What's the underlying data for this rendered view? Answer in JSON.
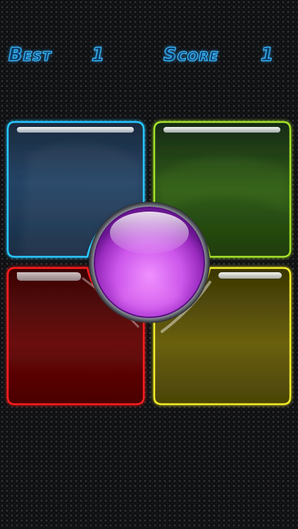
{
  "hud": {
    "best_label": "Best",
    "best_value": "1",
    "score_label": "Score",
    "score_value": "1"
  },
  "pads": [
    {
      "id": "top-left",
      "color_name": "blue",
      "color": "#26c8ff"
    },
    {
      "id": "top-right",
      "color_name": "green",
      "color": "#a6e22a"
    },
    {
      "id": "bottom-left",
      "color_name": "red",
      "color": "#ff1f1f"
    },
    {
      "id": "bottom-right",
      "color_name": "yellow",
      "color": "#f4ee2c"
    }
  ],
  "center_button": {
    "color_name": "purple",
    "color": "#d05cf0"
  }
}
